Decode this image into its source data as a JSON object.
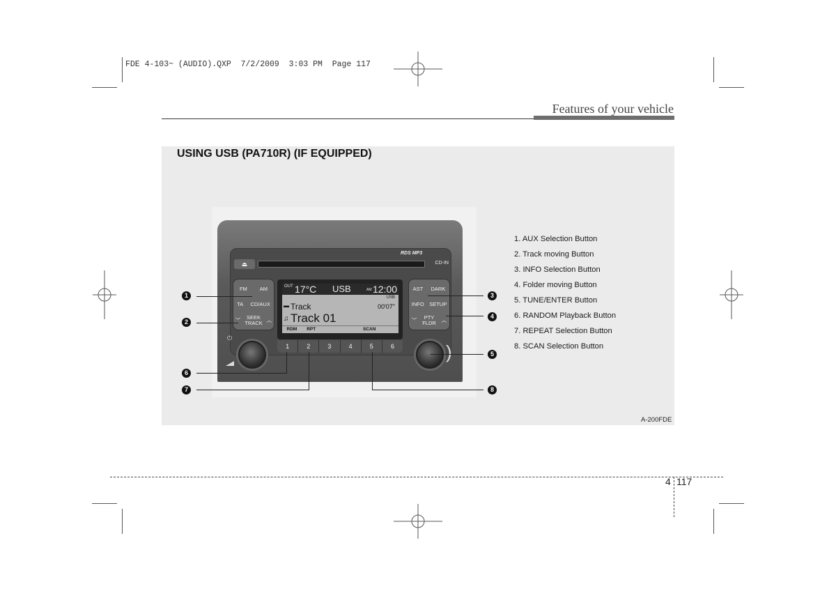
{
  "slug": "FDE 4-103~ (AUDIO).QXP  7/2/2009  3:03 PM  Page 117",
  "header": {
    "title": "Features of your vehicle"
  },
  "section": {
    "title": "USING USB (PA710R) (IF EQUIPPED)"
  },
  "radio": {
    "eject_icon": "eject-icon",
    "cd_in": "CD-IN",
    "logos": "RDS MP3",
    "left_buttons": {
      "fm": "FM",
      "am": "AM",
      "ta": "TA",
      "cdaux": "CD/AUX",
      "seek": "SEEK",
      "track": "TRACK"
    },
    "right_buttons": {
      "ast": "AST",
      "dark": "DARK",
      "info": "INFO",
      "setup": "SETUP",
      "pty": "PTY",
      "fldr": "FLDR"
    },
    "display": {
      "out_label": "OUT",
      "temperature": "17°C",
      "source": "USB",
      "am_pm": "AM",
      "clock": "12:00",
      "source_small": "USB",
      "folder_line": "Track",
      "elapsed": "00'07\"",
      "track_line": "Track 01",
      "softkeys": [
        "RDM",
        "RPT",
        "",
        "",
        "SCAN",
        ""
      ]
    },
    "presets": [
      "1",
      "2",
      "3",
      "4",
      "5",
      "6"
    ]
  },
  "callouts": [
    "1",
    "2",
    "3",
    "4",
    "5",
    "6",
    "7",
    "8"
  ],
  "legend": [
    "1. AUX Selection Button",
    "2. Track moving Button",
    "3. INFO Selection Button",
    "4. Folder moving Button",
    "5. TUNE/ENTER Button",
    "6. RANDOM Playback Button",
    "7. REPEAT Selection Button",
    "8. SCAN Selection Button"
  ],
  "figure_code": "A-200FDE",
  "footer": {
    "chapter": "4",
    "page": "117"
  }
}
